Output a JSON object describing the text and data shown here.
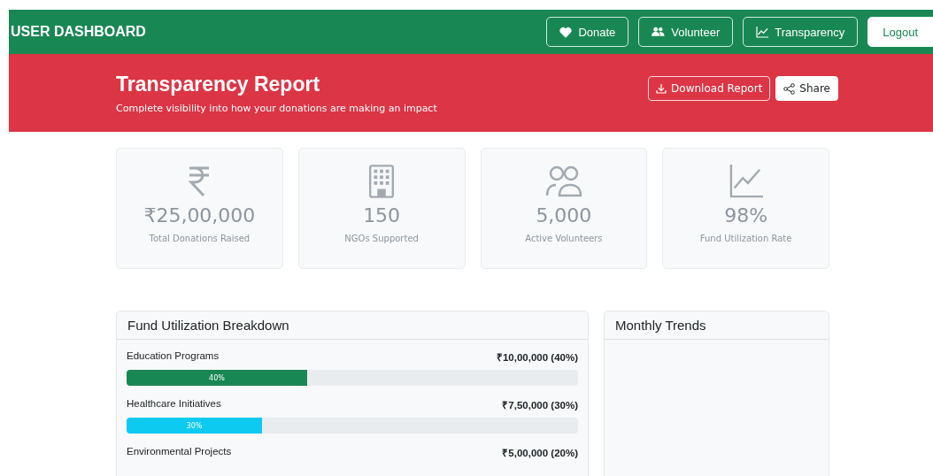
{
  "navbar": {
    "brand": "USER DASHBOARD",
    "buttons": [
      {
        "kind": "heart",
        "label": "Donate"
      },
      {
        "kind": "people",
        "label": "Volunteer"
      },
      {
        "kind": "chart",
        "label": "Transparency"
      },
      {
        "kind": "plain",
        "label": "Logout"
      }
    ]
  },
  "header": {
    "title": "Transparency Report",
    "subtitle": "Complete visibility into how your donations are making an impact",
    "buttons": [
      {
        "kind": "download",
        "label": "Download Report"
      },
      {
        "kind": "share",
        "label": "Share"
      }
    ]
  },
  "stats": [
    {
      "kind": "rupee",
      "value": "₹25,00,000",
      "label": "Total Donations Raised"
    },
    {
      "kind": "building",
      "value": "150",
      "label": "NGOs Supported"
    },
    {
      "kind": "people",
      "value": "5,000",
      "label": "Active Volunteers"
    },
    {
      "kind": "chart",
      "value": "98%",
      "label": "Fund Utilization Rate"
    }
  ],
  "breakdown": {
    "title": "Fund Utilization Breakdown",
    "items": [
      {
        "name": "Education Programs",
        "amount": "₹10,00,000 (40%)",
        "level": 0.4,
        "bar_label": "40%",
        "color": "#198754"
      },
      {
        "name": "Healthcare Initiatives",
        "amount": "₹7,50,000 (30%)",
        "level": 0.3,
        "bar_label": "30%",
        "color": "#0dcaf0"
      },
      {
        "name": "Environmental Projects",
        "amount": "₹5,00,000 (20%)"
      }
    ]
  },
  "trends": {
    "title": "Monthly Trends"
  }
}
